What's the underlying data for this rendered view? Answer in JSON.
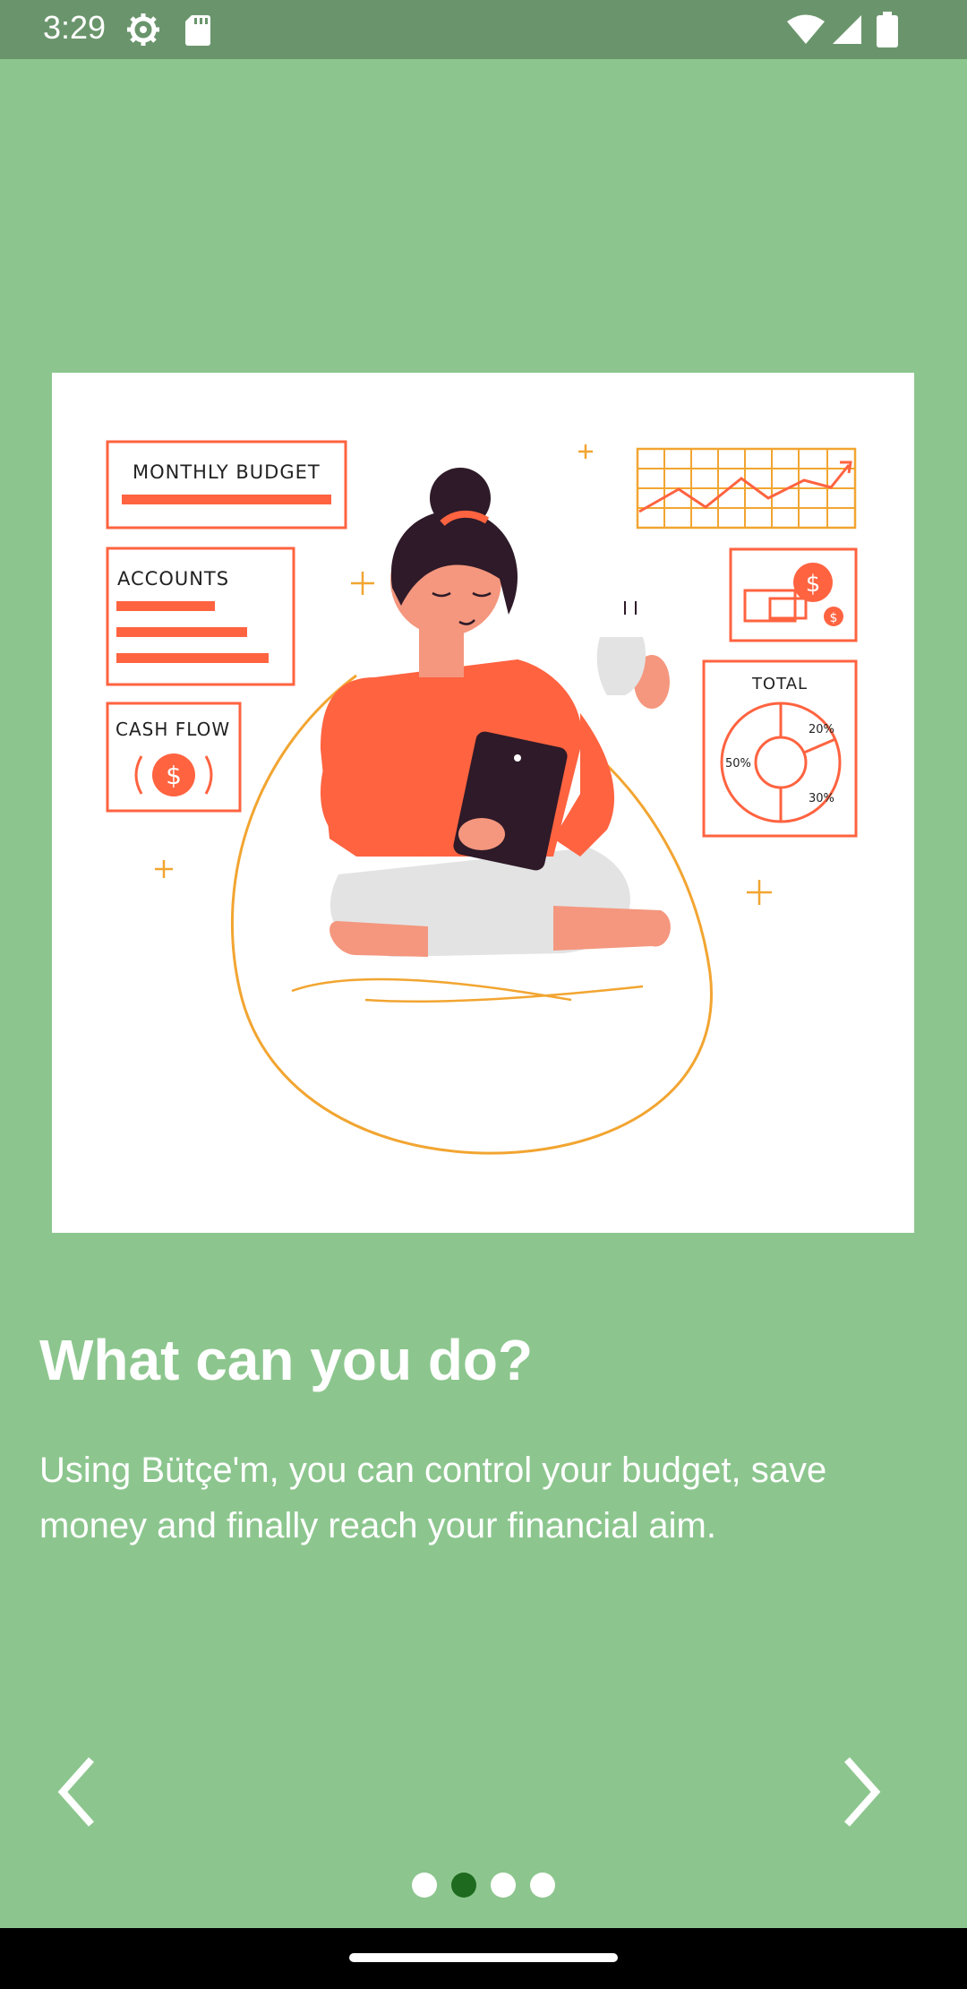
{
  "status_bar": {
    "time": "3:29",
    "icons": [
      "gear-icon",
      "sd-card-icon",
      "wifi-icon",
      "signal-icon",
      "battery-icon"
    ]
  },
  "illustration": {
    "labels": {
      "monthly_budget": "MONTHLY BUDGET",
      "accounts": "ACCOUNTS",
      "cash_flow": "CASH FLOW",
      "total": "TOTAL",
      "pct_20": "20%",
      "pct_50": "50%",
      "pct_30": "30%",
      "dollar": "$"
    }
  },
  "onboarding": {
    "title": "What can you do?",
    "description": "Using Bütçe'm, you can control your budget, save money and finally reach your financial aim."
  },
  "navigation": {
    "prev_icon": "chevron-left-icon",
    "next_icon": "chevron-right-icon"
  },
  "pager": {
    "page_count": 4,
    "current_index": 1
  },
  "colors": {
    "background": "#8CC68E",
    "status_bar": "#6A956C",
    "accent": "#FF6340",
    "gold": "#F2A531",
    "dot_active": "#1E6B20",
    "dot_inactive": "#FFFFFF"
  }
}
